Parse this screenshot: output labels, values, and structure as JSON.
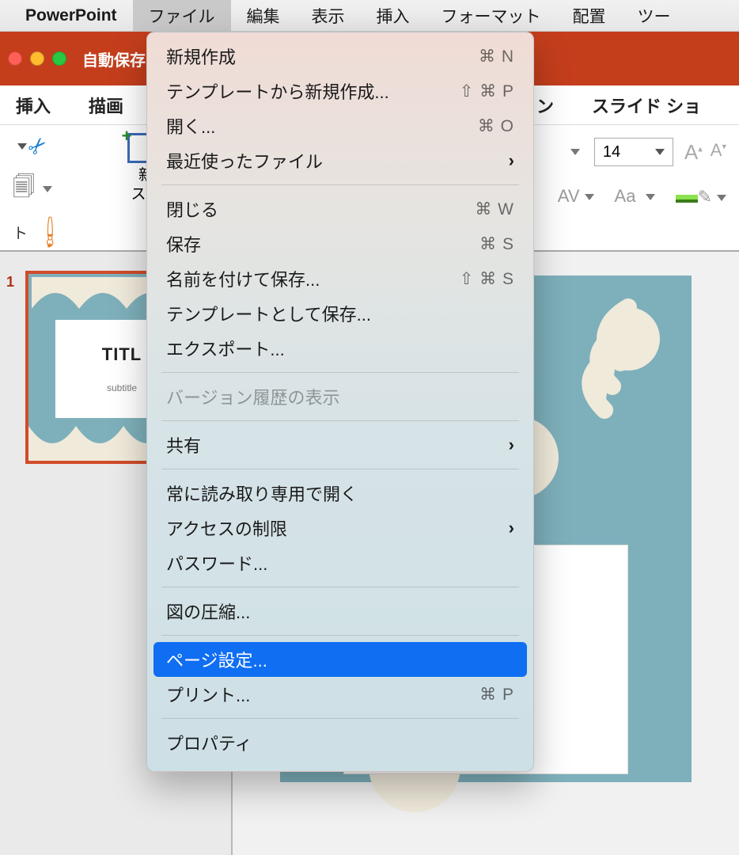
{
  "app_name": "PowerPoint",
  "menubar": [
    "ファイル",
    "編集",
    "表示",
    "挿入",
    "フォーマット",
    "配置",
    "ツー"
  ],
  "autosave_label": "自動保存",
  "ribbon_tabs": {
    "visible_left": [
      "挿入",
      "描画"
    ],
    "visible_right": [
      "ション",
      "スライド ショ"
    ]
  },
  "ribbon": {
    "clipboard_label": "ト",
    "new_slide_label_1": "新",
    "new_slide_label_2": "スラ",
    "font_size": "14",
    "aa_label": "Aa",
    "av_label": "AV"
  },
  "thumbnail": {
    "number": "1",
    "title": "TITL",
    "subtitle": "subtitle"
  },
  "file_menu": {
    "new": {
      "label": "新規作成",
      "shortcut": "⌘ N"
    },
    "new_from_template": {
      "label": "テンプレートから新規作成...",
      "shortcut": "⇧ ⌘ P"
    },
    "open": {
      "label": "開く...",
      "shortcut": "⌘ O"
    },
    "recent": {
      "label": "最近使ったファイル"
    },
    "close": {
      "label": "閉じる",
      "shortcut": "⌘ W"
    },
    "save": {
      "label": "保存",
      "shortcut": "⌘ S"
    },
    "save_as": {
      "label": "名前を付けて保存...",
      "shortcut": "⇧ ⌘ S"
    },
    "save_as_template": {
      "label": "テンプレートとして保存..."
    },
    "export": {
      "label": "エクスポート..."
    },
    "version_history": {
      "label": "バージョン履歴の表示"
    },
    "share": {
      "label": "共有"
    },
    "open_readonly": {
      "label": "常に読み取り専用で開く"
    },
    "restrict_access": {
      "label": "アクセスの制限"
    },
    "password": {
      "label": "パスワード..."
    },
    "compress_pictures": {
      "label": "図の圧縮..."
    },
    "page_setup": {
      "label": "ページ設定..."
    },
    "print": {
      "label": "プリント...",
      "shortcut": "⌘ P"
    },
    "properties": {
      "label": "プロパティ"
    }
  }
}
